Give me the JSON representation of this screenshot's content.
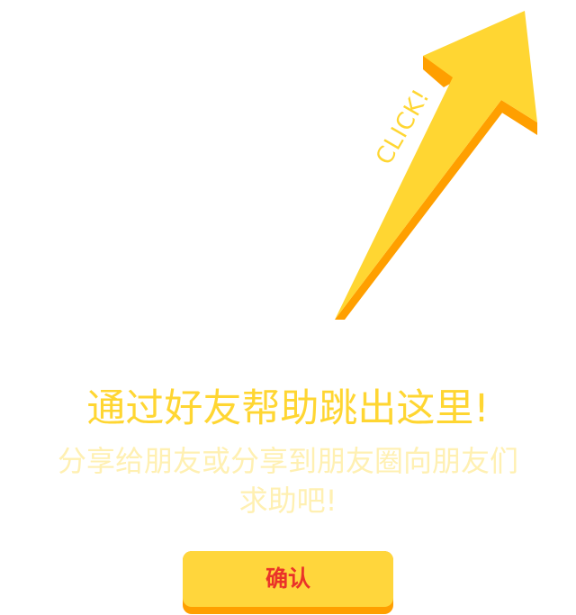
{
  "arrow": {
    "label": "CLICK!",
    "colors": {
      "face": "#ffd632",
      "shadow": "#ff9f00"
    }
  },
  "message": {
    "title": "通过好友帮助跳出这里!",
    "subtitle": "分享给朋友或分享到朋友圈向朋友们求助吧!"
  },
  "button": {
    "label": "确认",
    "colors": {
      "face": "#ffd63c",
      "shadow": "#ff9f00",
      "text": "#ea3329"
    }
  }
}
